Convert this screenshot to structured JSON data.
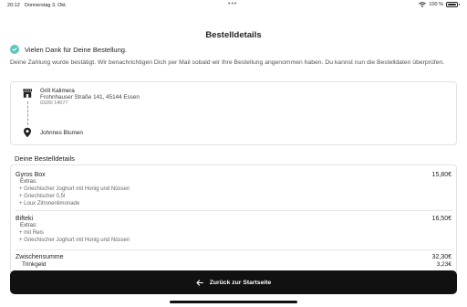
{
  "status_bar": {
    "time": "20:12",
    "date": "Donnerstag 3. Okt.",
    "dots": "•••",
    "battery_text": "100 %"
  },
  "page": {
    "title": "Bestelldetails"
  },
  "confirmation": {
    "thanks": "Vielen Dank für Deine Bestellung.",
    "info": "Deine Zahlung wurde bestätigt. Wir benachrichtigen Dich per Mail sobald wir Ihre Bestellung angenommen haben. Du kannst nun die Bestelldaten überprüfen."
  },
  "route": {
    "store_name": "Grill Kalimera",
    "store_address": "Frohnhauser Straße 141, 45144 Essen",
    "store_phone": "0326I 14077",
    "customer_name": "Johnnes Blumen"
  },
  "details": {
    "heading": "Deine Bestelldetails",
    "items": [
      {
        "name": "Gyros Box",
        "price": "15,80€",
        "extras_label": "Extras:",
        "extras": [
          "+ Griechischer Joghurt mit Honig und Nüssen",
          "+ Griechischer 0,5l",
          "+ Loux Zitronenlimonade"
        ]
      },
      {
        "name": "Bifteki",
        "price": "16,50€",
        "extras_label": "Extras:",
        "extras": [
          "+ mit Reis",
          "+ Griechischer Joghurt mit Honig und Nüssen"
        ]
      }
    ],
    "subtotal_label": "Zwischensumme",
    "subtotal_value": "32,30€",
    "tip_label": "Trinkgeld",
    "tip_value": "3,23€"
  },
  "footer": {
    "back_button_label": "Zurück zur Startseite"
  },
  "colors": {
    "accent": "#5ec6b6",
    "button": "#111111"
  }
}
